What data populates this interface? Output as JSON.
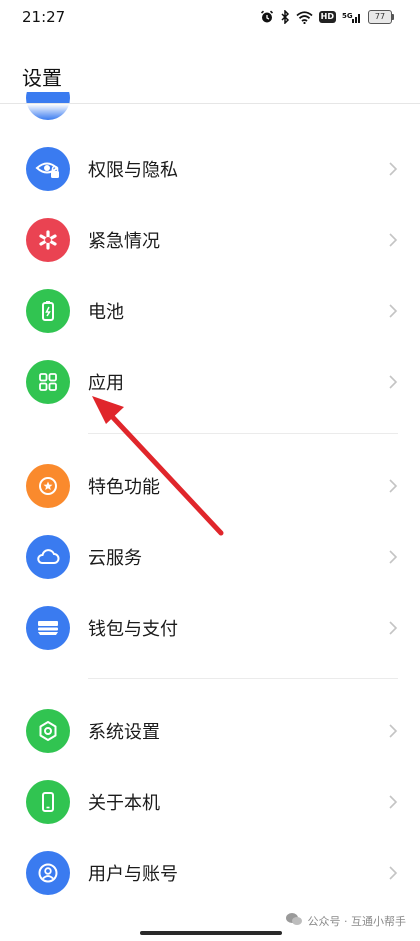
{
  "status_bar": {
    "time": "21:27",
    "battery": "77",
    "hd_badge": "HD",
    "network": "5G"
  },
  "header": {
    "title": "设置"
  },
  "groups": [
    {
      "items": [
        {
          "label": "权限与隐私",
          "icon": "eye-lock-icon",
          "color": "#3a7bf0"
        },
        {
          "label": "紧急情况",
          "icon": "asterisk-icon",
          "color": "#ea4352"
        },
        {
          "label": "电池",
          "icon": "battery-icon",
          "color": "#31c451"
        },
        {
          "label": "应用",
          "icon": "apps-grid-icon",
          "color": "#31c451"
        }
      ]
    },
    {
      "items": [
        {
          "label": "特色功能",
          "icon": "star-badge-icon",
          "color": "#fa8a2d"
        },
        {
          "label": "云服务",
          "icon": "cloud-icon",
          "color": "#3a7bf0"
        },
        {
          "label": "钱包与支付",
          "icon": "wallet-icon",
          "color": "#3a7bf0"
        }
      ]
    },
    {
      "items": [
        {
          "label": "系统设置",
          "icon": "hexagon-gear-icon",
          "color": "#31c451"
        },
        {
          "label": "关于本机",
          "icon": "phone-icon",
          "color": "#31c451"
        },
        {
          "label": "用户与账号",
          "icon": "user-icon",
          "color": "#3a7bf0"
        }
      ]
    }
  ],
  "watermark": {
    "text": "公众号 · 互通小帮手"
  }
}
